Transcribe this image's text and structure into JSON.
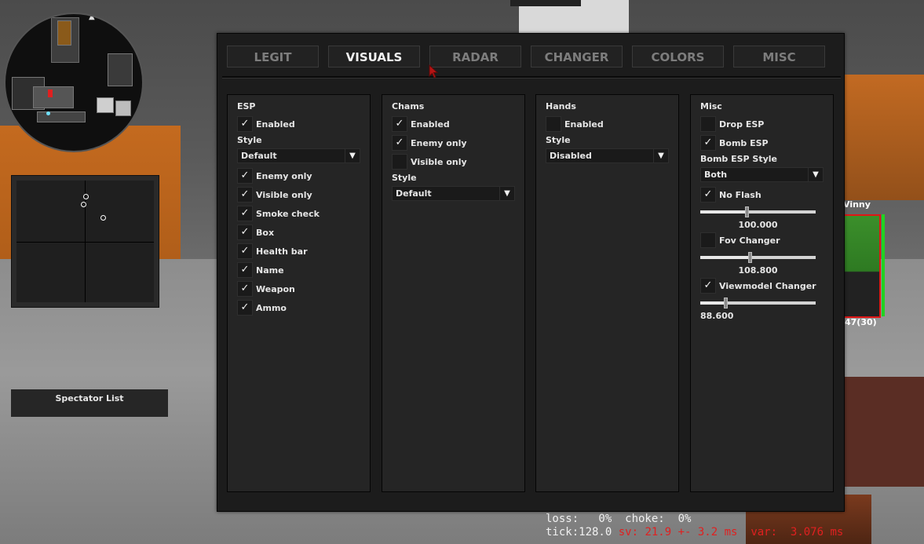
{
  "tabs": [
    {
      "label": "LEGIT",
      "active": false
    },
    {
      "label": "VISUALS",
      "active": true
    },
    {
      "label": "RADAR",
      "active": false
    },
    {
      "label": "CHANGER",
      "active": false
    },
    {
      "label": "COLORS",
      "active": false
    },
    {
      "label": "MISC",
      "active": false
    }
  ],
  "esp": {
    "title": "ESP",
    "enabled": {
      "label": "Enabled",
      "checked": true
    },
    "style_label": "Style",
    "style_value": "Default",
    "options": [
      {
        "label": "Enemy only",
        "checked": true
      },
      {
        "label": "Visible only",
        "checked": true
      },
      {
        "label": "Smoke check",
        "checked": true
      },
      {
        "label": "Box",
        "checked": true
      },
      {
        "label": "Health bar",
        "checked": true
      },
      {
        "label": "Name",
        "checked": true
      },
      {
        "label": "Weapon",
        "checked": true
      },
      {
        "label": "Ammo",
        "checked": true
      }
    ]
  },
  "chams": {
    "title": "Chams",
    "options": [
      {
        "label": "Enabled",
        "checked": true
      },
      {
        "label": "Enemy only",
        "checked": true
      },
      {
        "label": "Visible only",
        "checked": false
      }
    ],
    "style_label": "Style",
    "style_value": "Default"
  },
  "hands": {
    "title": "Hands",
    "enabled": {
      "label": "Enabled",
      "checked": false
    },
    "style_label": "Style",
    "style_value": "Disabled"
  },
  "misc": {
    "title": "Misc",
    "drop_esp": {
      "label": "Drop ESP",
      "checked": false
    },
    "bomb_esp": {
      "label": "Bomb ESP",
      "checked": true
    },
    "bomb_style_label": "Bomb ESP Style",
    "bomb_style_value": "Both",
    "no_flash": {
      "label": "No Flash",
      "checked": true
    },
    "no_flash_value": "100.000",
    "no_flash_fraction": 0.4,
    "fov_changer": {
      "label": "Fov Changer",
      "checked": false
    },
    "fov_value": "108.800",
    "fov_fraction": 0.43,
    "viewmodel_changer": {
      "label": "Viewmodel Changer",
      "checked": true
    },
    "viewmodel_value": "88.600",
    "viewmodel_fraction": 0.22
  },
  "spectator_list": "Spectator List",
  "esp_player": {
    "name": "Vinny",
    "ammo": "47(30)"
  },
  "netgraph": {
    "line1": "loss:   0%  choke:  0%",
    "tick": "tick:128.0",
    "sv": "sv: 21.9 +- 3.2 ms",
    "var": "var:  3.076 ms"
  },
  "colors": {
    "check": "#f0f0f0",
    "health": "#21d321",
    "esp_box": "#e01515",
    "netgraph_warn": "#e02020"
  },
  "icons": {
    "check": "check-icon",
    "dropdown": "triangle-down-icon"
  }
}
